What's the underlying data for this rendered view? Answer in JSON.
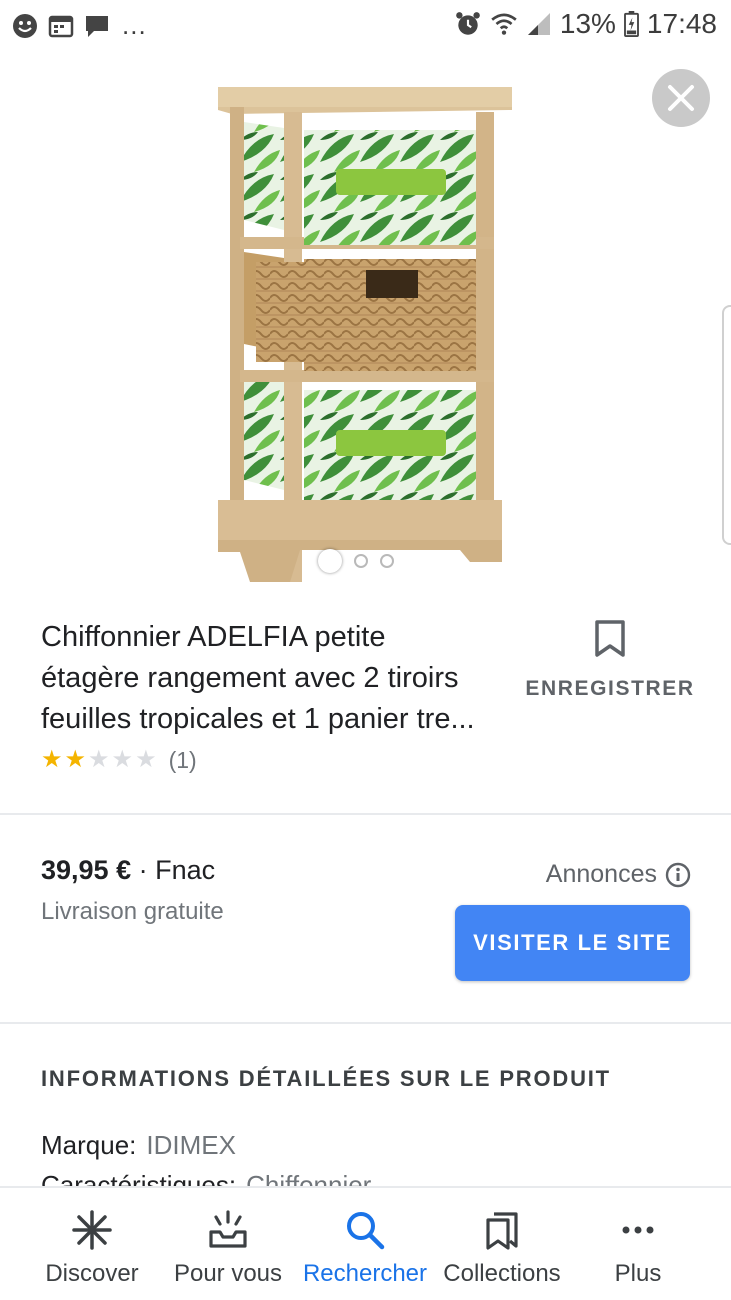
{
  "status_bar": {
    "battery": "13%",
    "time": "17:48",
    "more": "..."
  },
  "product": {
    "title_line1": "Chiffonnier ADELFIA petite",
    "title_line2": "étagère rangement avec 2 tiroirs",
    "title_line3": "feuilles tropicales et 1 panier tre...",
    "rating": 2,
    "rating_max": 5,
    "rating_count": "(1)",
    "save_label": "ENREGISTRER",
    "image_count": 3,
    "image_index": 1
  },
  "offer": {
    "price": "39,95 €",
    "separator": " · ",
    "seller": "Fnac",
    "shipping": "Livraison gratuite",
    "ads_label": "Annonces",
    "visit_button": "VISITER LE SITE"
  },
  "details": {
    "heading": "INFORMATIONS DÉTAILLÉES SUR LE PRODUIT",
    "rows": [
      {
        "key": "Marque:",
        "value": "IDIMEX"
      },
      {
        "key": "Caractéristiques:",
        "value": "Chiffonnier"
      }
    ]
  },
  "bottom_nav": {
    "items": [
      {
        "label": "Discover",
        "icon": "asterisk-icon"
      },
      {
        "label": "Pour vous",
        "icon": "inbox-icon"
      },
      {
        "label": "Rechercher",
        "icon": "search-icon"
      },
      {
        "label": "Collections",
        "icon": "bookmarks-icon"
      },
      {
        "label": "Plus",
        "icon": "more-horizontal-icon"
      }
    ],
    "active": "Rechercher"
  },
  "colors": {
    "accent": "#1a73e8",
    "button": "#4285f4",
    "star": "#f4b400"
  }
}
